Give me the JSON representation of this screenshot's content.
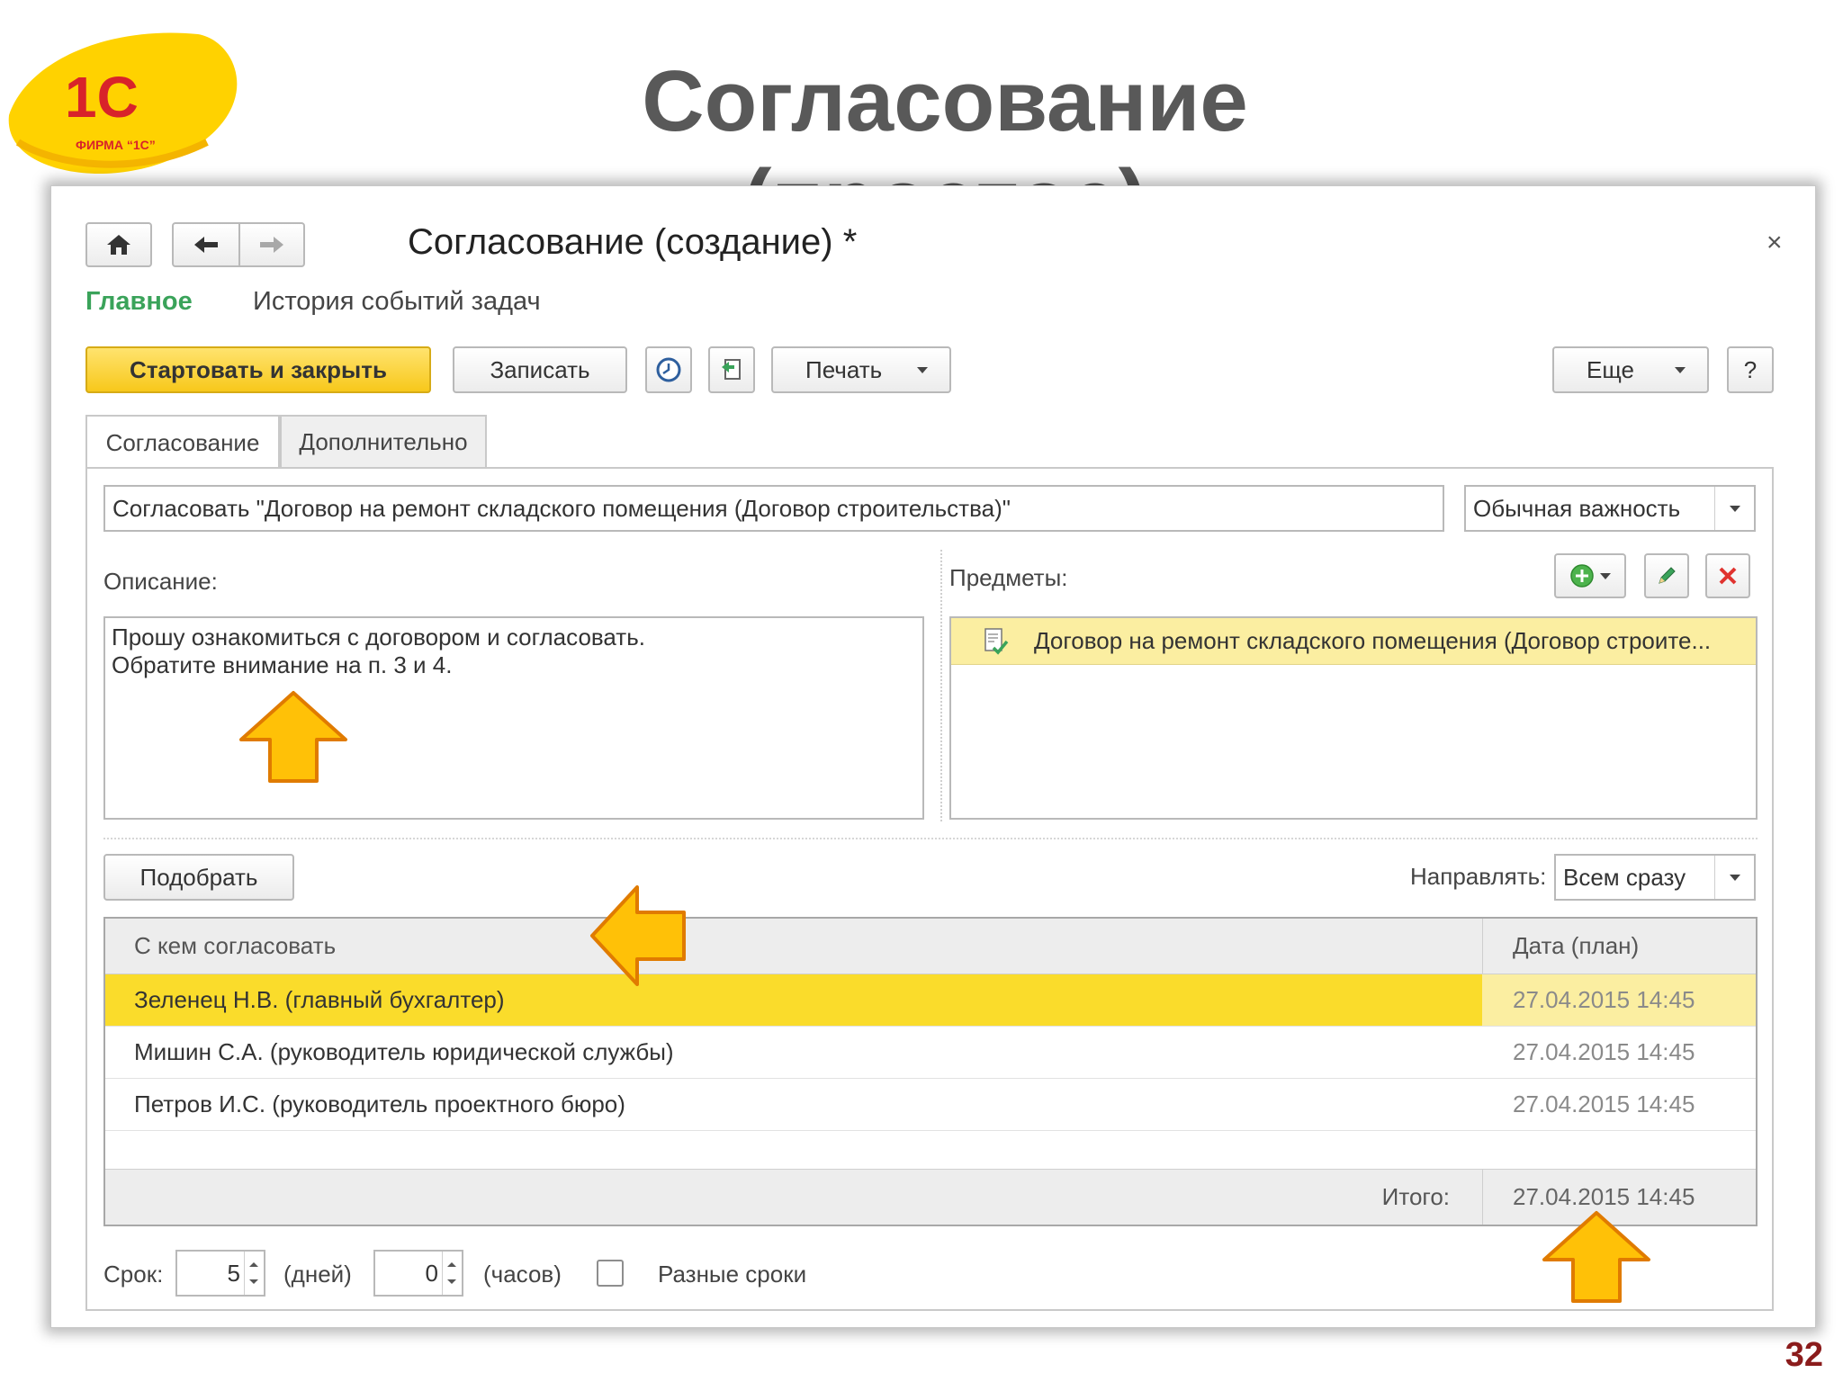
{
  "slide": {
    "title": "Согласование (простое)",
    "page_number": "32",
    "logo_text_main": "1С",
    "logo_text_sub": "ФИРМА “1С”"
  },
  "window": {
    "title": "Согласование (создание) *",
    "close_glyph": "×",
    "nav": {
      "main_label": "Главное",
      "history_label": "История событий задач"
    },
    "toolbar": {
      "start_close_label": "Стартовать и закрыть",
      "save_label": "Записать",
      "print_label": "Печать",
      "more_label": "Еще",
      "help_label": "?"
    },
    "tabs": [
      {
        "label": "Согласование"
      },
      {
        "label": "Дополнительно"
      }
    ],
    "subject_value": "Согласовать \"Договор на ремонт складского помещения (Договор строительства)\"",
    "importance_value": "Обычная важность",
    "description_label": "Описание:",
    "description_text": "Прошу ознакомиться с договором и согласовать.\nОбратите внимание на п. 3 и 4.",
    "subjects_label": "Предметы:",
    "subjects": [
      {
        "text": "Договор на ремонт складского помещения (Договор строите..."
      }
    ],
    "pick_label": "Подобрать",
    "route_label": "Направлять:",
    "route_value": "Всем сразу",
    "table": {
      "col_who": "С кем согласовать",
      "col_date": "Дата (план)",
      "rows": [
        {
          "who": "Зеленец Н.В. (главный бухгалтер)",
          "date": "27.04.2015 14:45"
        },
        {
          "who": "Мишин С.А. (руководитель юридической службы)",
          "date": "27.04.2015 14:45"
        },
        {
          "who": "Петров И.С. (руководитель проектного бюро)",
          "date": "27.04.2015 14:45"
        }
      ],
      "total_label": "Итого:",
      "total_date": "27.04.2015 14:45"
    },
    "deadline": {
      "label": "Срок:",
      "days_value": "5",
      "days_unit": "(дней)",
      "hours_value": "0",
      "hours_unit": "(часов)",
      "different_label": "Разные сроки"
    }
  },
  "colors": {
    "accent_yellow": "#f7c81b",
    "selection_yellow": "#fadc2b",
    "nav_green": "#3aa35a",
    "arrow_orange": "#f5a623"
  }
}
